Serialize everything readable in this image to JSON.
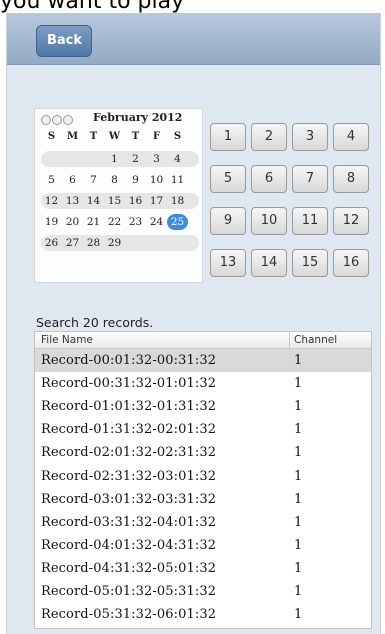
{
  "caption": "you want to play",
  "nav": {
    "back_label": "Back"
  },
  "calendar": {
    "title": "February 2012",
    "dow": [
      "S",
      "M",
      "T",
      "W",
      "T",
      "F",
      "S"
    ],
    "weeks": [
      [
        "",
        "",
        "",
        "1",
        "2",
        "3",
        "4"
      ],
      [
        "5",
        "6",
        "7",
        "8",
        "9",
        "10",
        "11"
      ],
      [
        "12",
        "13",
        "14",
        "15",
        "16",
        "17",
        "18"
      ],
      [
        "19",
        "20",
        "21",
        "22",
        "23",
        "24",
        "25"
      ],
      [
        "26",
        "27",
        "28",
        "29",
        "",
        "",
        ""
      ]
    ],
    "selected": "25"
  },
  "channels": [
    "1",
    "2",
    "3",
    "4",
    "5",
    "6",
    "7",
    "8",
    "9",
    "10",
    "11",
    "12",
    "13",
    "14",
    "15",
    "16"
  ],
  "search": {
    "summary": "Search 20 records."
  },
  "table": {
    "headers": [
      "File Name",
      "Channel"
    ],
    "rows": [
      {
        "name": "Record-00:01:32-00:31:32",
        "channel": "1"
      },
      {
        "name": "Record-00:31:32-01:01:32",
        "channel": "1"
      },
      {
        "name": "Record-01:01:32-01:31:32",
        "channel": "1"
      },
      {
        "name": "Record-01:31:32-02:01:32",
        "channel": "1"
      },
      {
        "name": "Record-02:01:32-02:31:32",
        "channel": "1"
      },
      {
        "name": "Record-02:31:32-03:01:32",
        "channel": "1"
      },
      {
        "name": "Record-03:01:32-03:31:32",
        "channel": "1"
      },
      {
        "name": "Record-03:31:32-04:01:32",
        "channel": "1"
      },
      {
        "name": "Record-04:01:32-04:31:32",
        "channel": "1"
      },
      {
        "name": "Record-04:31:32-05:01:32",
        "channel": "1"
      },
      {
        "name": "Record-05:01:32-05:31:32",
        "channel": "1"
      },
      {
        "name": "Record-05:31:32-06:01:32",
        "channel": "1"
      }
    ],
    "selected_row": 0
  }
}
